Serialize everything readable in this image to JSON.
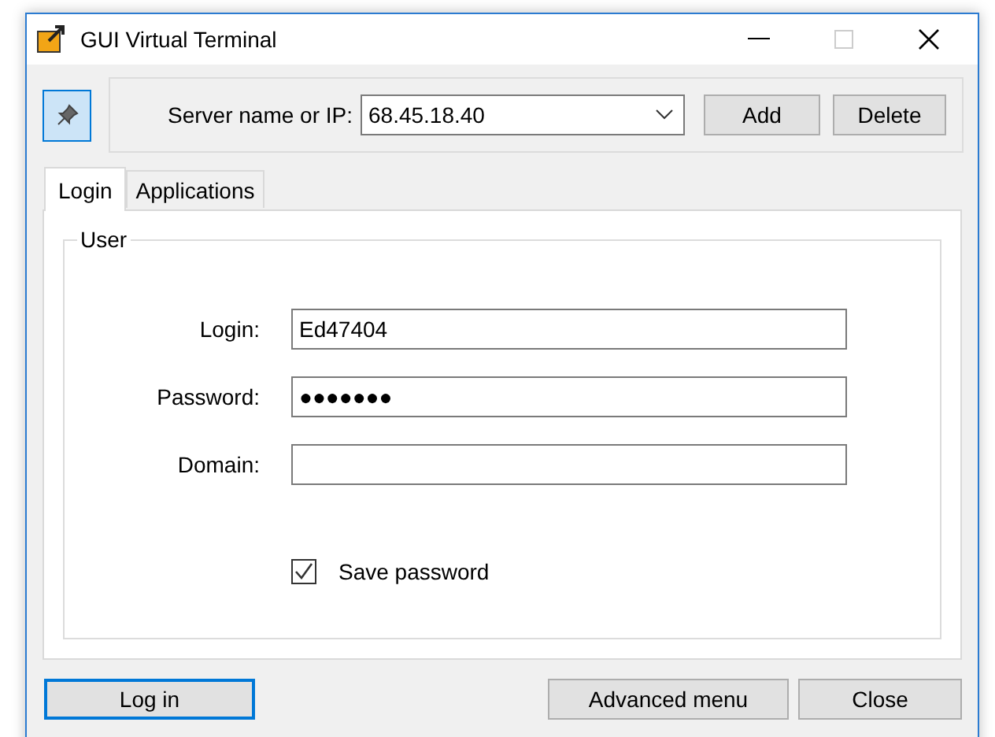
{
  "window": {
    "title": "GUI Virtual Terminal"
  },
  "server": {
    "pinned": true,
    "label": "Server name or IP:",
    "value": "68.45.18.40",
    "buttons": [
      "Add",
      "Delete"
    ]
  },
  "tabs": [
    {
      "label": "Login",
      "selected": true
    },
    {
      "label": "Applications",
      "selected": false
    }
  ],
  "user_group": {
    "title": "User",
    "fields": [
      {
        "label": "Login:",
        "value": "Ed47404"
      },
      {
        "label": "Password:",
        "value": "●●●●●●●"
      },
      {
        "label": "Domain:"
      }
    ],
    "save_password": {
      "label": "Save password",
      "checked": true
    }
  },
  "buttons": [
    {
      "label": "Log in",
      "focused": true
    },
    {
      "label": "Advanced menu",
      "focused": false
    },
    {
      "label": "Close",
      "focused": false
    }
  ]
}
